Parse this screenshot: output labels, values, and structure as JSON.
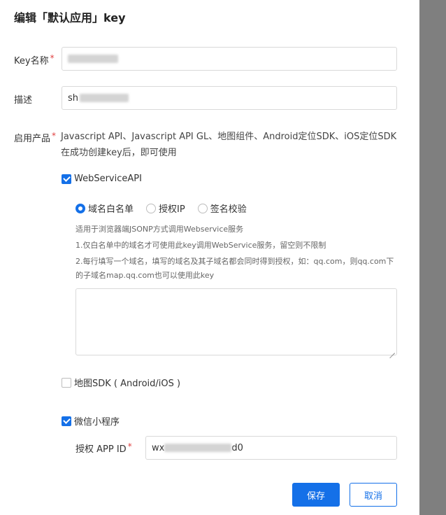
{
  "dialog": {
    "title": "编辑「默认应用」key"
  },
  "form": {
    "key_name_label": "Key名称",
    "key_name_value": "",
    "desc_label": "描述",
    "desc_value": "sh",
    "product_label": "启用产品",
    "product_desc": "Javascript API、Javascript API GL、地图组件、Android定位SDK、iOS定位SDK在成功创建key后，即可使用",
    "required_mark": "*",
    "webservice": {
      "label": "WebServiceAPI",
      "checked": true,
      "radios": [
        {
          "label": "域名白名单",
          "selected": true
        },
        {
          "label": "授权IP",
          "selected": false
        },
        {
          "label": "签名校验",
          "selected": false
        }
      ],
      "help": [
        "适用于浏览器端JSONP方式调用Webservice服务",
        "1.仅白名单中的域名才可使用此key调用WebService服务，留空则不限制",
        "2.每行填写一个域名，填写的域名及其子域名都会同时得到授权，如：qq.com，则qq.com下的子域名map.qq.com也可以使用此key"
      ],
      "textarea_value": ""
    },
    "map_sdk": {
      "label": "地图SDK ( Android/iOS )",
      "checked": false
    },
    "miniprogram": {
      "label": "微信小程序",
      "checked": true,
      "appid_label": "授权 APP ID",
      "appid_prefix": "wx",
      "appid_suffix": "d0"
    }
  },
  "buttons": {
    "save": "保存",
    "cancel": "取消"
  },
  "colors": {
    "primary": "#1470e8",
    "required": "#e04040"
  }
}
